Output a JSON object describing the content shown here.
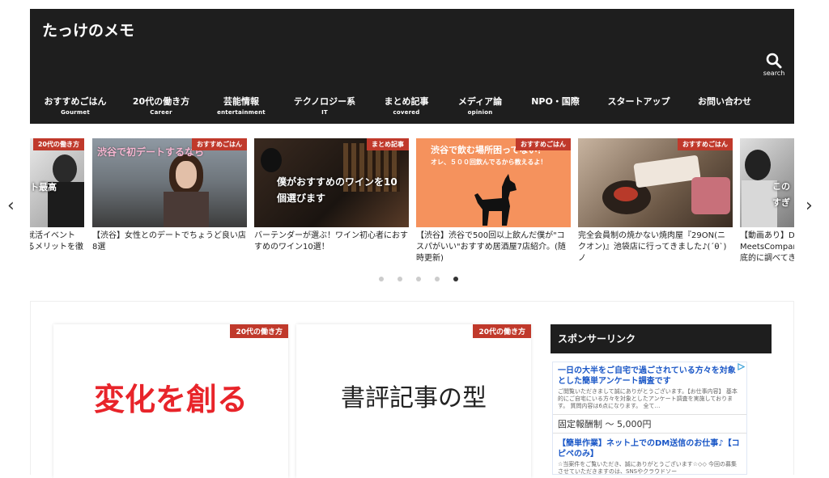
{
  "site": {
    "title": "たっけのメモ",
    "search_label": "search"
  },
  "nav": [
    {
      "ja": "おすすめごはん",
      "en": "Gourmet"
    },
    {
      "ja": "20代の働き方",
      "en": "Career"
    },
    {
      "ja": "芸能情報",
      "en": "entertainment"
    },
    {
      "ja": "テクノロジー系",
      "en": "IT"
    },
    {
      "ja": "まとめ記事",
      "en": "covered"
    },
    {
      "ja": "メディア論",
      "en": "opinion"
    },
    {
      "ja": "NPO・国際",
      "en": ""
    },
    {
      "ja": "スタートアップ",
      "en": ""
    },
    {
      "ja": "お問い合わせ",
      "en": ""
    }
  ],
  "slides": [
    {
      "badge": "20代の働き方",
      "overlay": "ト最高",
      "caption": "就活イベント\nるメリットを徹"
    },
    {
      "badge": "おすすめごはん",
      "overlay": "渋谷で初デートするなら",
      "caption": "【渋谷】女性とのデートでちょうど良い店8選"
    },
    {
      "badge": "まとめ記事",
      "overlay": "僕がおすすめのワインを10個選びます",
      "caption": "バーテンダーが選ぶ！ワイン初心者におすすめのワイン10選！"
    },
    {
      "badge": "おすすめごはん",
      "overlay": "渋谷で飲む場所困ってない？",
      "overlay2": "オレ、５００回飲んでるから教えるよ！",
      "caption": "【渋谷】渋谷で500回以上飲んだ僕が\"コスパがいい\"おすすめ居酒屋7店紹介。(随時更新)"
    },
    {
      "badge": "おすすめごはん",
      "overlay": "",
      "caption": "完全会員制の焼かない焼肉屋『29ON(ニクオン)』池袋店に行ってきました♪(´θ`)ノ"
    },
    {
      "badge": "",
      "overlay": "この\nすぎ",
      "caption": "【動画あり】D\nMeetsCompar\n底的に調べてき"
    }
  ],
  "slider": {
    "prev": "‹",
    "next": "›",
    "dot_count": 5,
    "active_dot": 5
  },
  "cards": [
    {
      "badge": "20代の働き方",
      "title": "変化を創る",
      "title_color": "#e8242a"
    },
    {
      "badge": "20代の働き方",
      "title": "書評記事の型",
      "title_color": "#222222"
    }
  ],
  "sidebar": {
    "title": "スポンサーリンク",
    "ad1": {
      "headline": "一日の大半をご自宅で過ごされている方々を対象とした簡単アンケート調査です",
      "desc": "ご閲覧いただきまして誠にありがとうございます。【お仕事内容】 基本的にご自宅にいる方々を対象としたアンケート調査を実施しております。 質問内容は6点になります。 全て…",
      "price": "固定報酬制 〜 5,000円"
    },
    "ad2": {
      "headline": "【簡単作業】ネット上でのDM送信のお仕事♪【コピペのみ】",
      "desc": "☆当案件をご覧いただき、誠にありがとうございます☆◇◇ 今回の募集させていただきますのは、SNSやクラウドソー"
    }
  },
  "colors": {
    "header_bg": "#1e1e1e",
    "badge": "#c0392b",
    "ad_link": "#1a57c7"
  }
}
